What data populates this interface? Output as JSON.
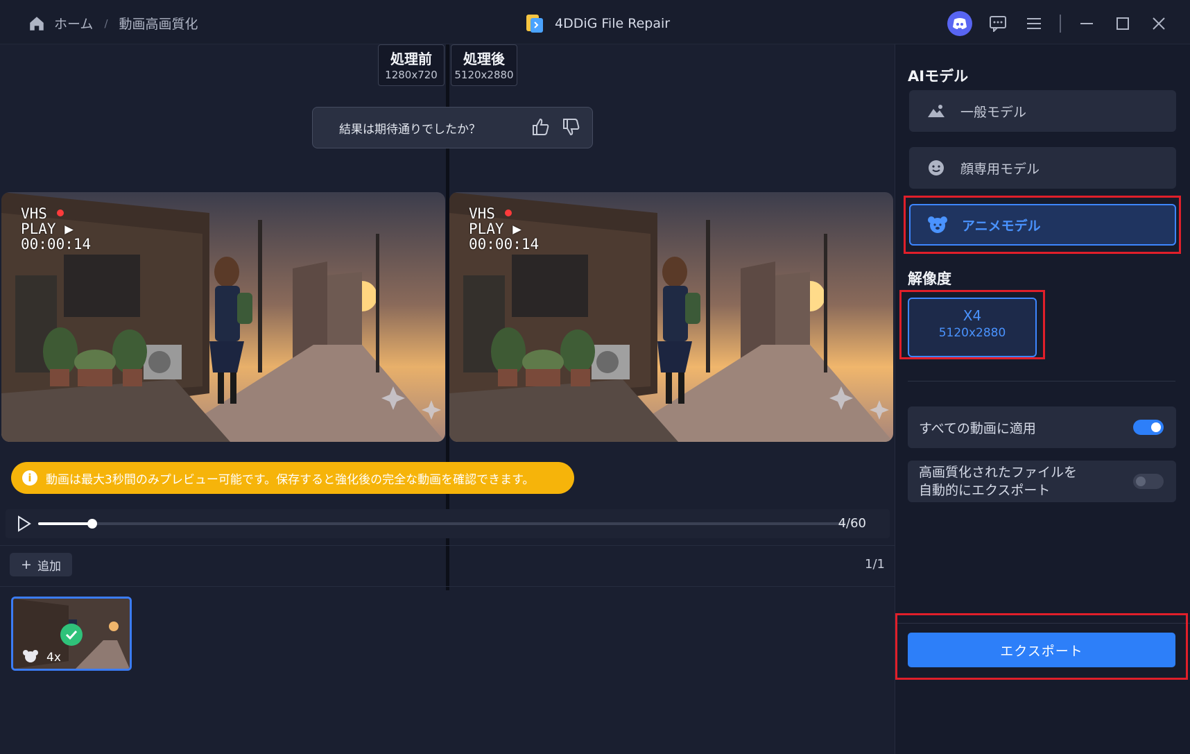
{
  "breadcrumb": {
    "home": "ホーム",
    "separator": "/",
    "current": "動画高画質化"
  },
  "app": {
    "title": "4DDiG File Repair"
  },
  "compare": {
    "before": {
      "label": "処理前",
      "resolution": "1280x720"
    },
    "after": {
      "label": "処理後",
      "resolution": "5120x2880"
    }
  },
  "feedback": {
    "question": "結果は期待通りでしたか？"
  },
  "video": {
    "overlay": [
      "VHS",
      "PLAY",
      "00:00:14"
    ]
  },
  "notice": {
    "text": "動画は最大3秒間のみプレビュー可能です。保存すると強化後の完全な動画を確認できます。"
  },
  "player": {
    "position": 4,
    "total": 60,
    "counter": "4/60"
  },
  "files": {
    "add_label": "追加",
    "page": "1/1",
    "thumb_scale": "4x"
  },
  "sidebar": {
    "ai_model_title": "AIモデル",
    "models": [
      {
        "label": "一般モデル",
        "icon": "landscape-icon",
        "selected": false
      },
      {
        "label": "顔専用モデル",
        "icon": "face-icon",
        "selected": false
      },
      {
        "label": "アニメモデル",
        "icon": "bear-icon",
        "selected": true
      }
    ],
    "resolution_title": "解像度",
    "resolution": {
      "scale": "X4",
      "size": "5120x2880"
    },
    "apply_all": {
      "label": "すべての動画に適用",
      "on": true
    },
    "auto_export": {
      "line1": "高画質化されたファイルを",
      "line2": "自動的にエクスポート",
      "on": false
    },
    "export_label": "エクスポート"
  },
  "colors": {
    "accent": "#2d7ff9",
    "highlight": "#e01f2a",
    "notice": "#f6b40a"
  }
}
